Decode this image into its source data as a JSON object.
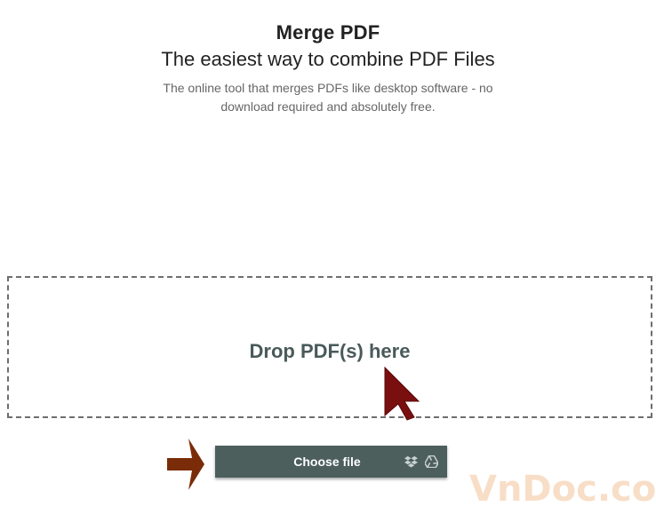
{
  "header": {
    "title": "Merge PDF",
    "subtitle": "The easiest way to combine PDF Files",
    "description": "The online tool that merges PDFs like desktop software - no download required and absolutely free."
  },
  "drop_zone": {
    "label": "Drop PDF(s) here"
  },
  "upload": {
    "choose_file_label": "Choose file",
    "icons": [
      "dropbox-icon",
      "google-drive-icon"
    ]
  },
  "annotations": {
    "cursor": "mouse-cursor-icon",
    "arrow": "right-arrow-icon"
  },
  "watermark": {
    "text": "VnDoc.com"
  },
  "colors": {
    "button": "#4c5f5d",
    "drop_text": "#4a5a5a",
    "cursor": "#7a0f0f",
    "arrow": "#7a2c08",
    "watermark": "#f6d3b5"
  }
}
